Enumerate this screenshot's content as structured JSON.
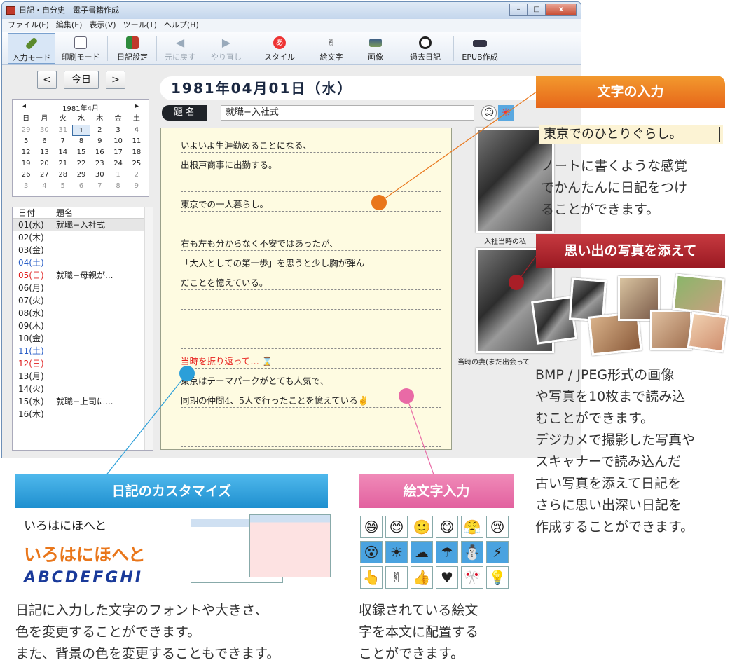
{
  "window": {
    "title": "日記・自分史　電子書籍作成",
    "min": "–",
    "max": "□",
    "close": "x"
  },
  "menu": [
    "ファイル(F)",
    "編集(E)",
    "表示(V)",
    "ツール(T)",
    "ヘルプ(H)"
  ],
  "toolbar": {
    "input_mode": "入力モード",
    "print_mode": "印刷モード",
    "diary_settings": "日記設定",
    "undo": "元に戻す",
    "redo": "やり直し",
    "style": "スタイル",
    "emoji": "絵文字",
    "image": "画像",
    "past_diary": "過去日記",
    "epub": "EPUB作成"
  },
  "nav": {
    "prev": "<",
    "today": "今日",
    "next": ">"
  },
  "calendar": {
    "header": "1981年4月",
    "prev": "◂",
    "next": "▸",
    "weekdays": [
      "日",
      "月",
      "火",
      "水",
      "木",
      "金",
      "土"
    ],
    "days": [
      [
        "29",
        "30",
        "31",
        "1",
        "2",
        "3",
        "4"
      ],
      [
        "5",
        "6",
        "7",
        "8",
        "9",
        "10",
        "11"
      ],
      [
        "12",
        "13",
        "14",
        "15",
        "16",
        "17",
        "18"
      ],
      [
        "19",
        "20",
        "21",
        "22",
        "23",
        "24",
        "25"
      ],
      [
        "26",
        "27",
        "28",
        "29",
        "30",
        "1",
        "2"
      ],
      [
        "3",
        "4",
        "5",
        "6",
        "7",
        "8",
        "9"
      ]
    ]
  },
  "list": {
    "col_date": "日付",
    "col_title": "題名",
    "rows": [
      {
        "d": "01(水)",
        "t": "就職−入社式",
        "c": "#222"
      },
      {
        "d": "02(木)",
        "t": "",
        "c": "#222"
      },
      {
        "d": "03(金)",
        "t": "",
        "c": "#222"
      },
      {
        "d": "04(土)",
        "t": "",
        "c": "#2a5fc7"
      },
      {
        "d": "05(日)",
        "t": "就職−母親が...",
        "c": "#e02020"
      },
      {
        "d": "06(月)",
        "t": "",
        "c": "#222"
      },
      {
        "d": "07(火)",
        "t": "",
        "c": "#222"
      },
      {
        "d": "08(水)",
        "t": "",
        "c": "#222"
      },
      {
        "d": "09(木)",
        "t": "",
        "c": "#222"
      },
      {
        "d": "10(金)",
        "t": "",
        "c": "#222"
      },
      {
        "d": "11(土)",
        "t": "",
        "c": "#2a5fc7"
      },
      {
        "d": "12(日)",
        "t": "",
        "c": "#e02020"
      },
      {
        "d": "13(月)",
        "t": "",
        "c": "#222"
      },
      {
        "d": "14(火)",
        "t": "",
        "c": "#222"
      },
      {
        "d": "15(水)",
        "t": "就職−上司に...",
        "c": "#222"
      },
      {
        "d": "16(木)",
        "t": "",
        "c": "#222"
      }
    ]
  },
  "entry": {
    "date": "1981年04月01日（水）",
    "title_label": "題 名",
    "title_value": "就職−入社式",
    "lines": [
      "いよいよ生涯勤めることになる、",
      "出根戸商事に出勤する。",
      "",
      "東京での一人暮らし。",
      "",
      "右も左も分からなく不安ではあったが、",
      "「大人としての第一歩」を思うと少し胸が弾ん",
      "だことを憶えている。",
      "",
      "",
      "",
      "当時を振り返って… ⌛",
      "東京はテーマパークがとても人気で、",
      "同期の仲間4、5人で行ったことを憶えている✌",
      "",
      ""
    ]
  },
  "photos": {
    "cap1": "入社当時の私",
    "cap2": "当時の妻(まだ出会って"
  },
  "callouts": {
    "text_input": {
      "title": "文字の入力",
      "sample": "東京でのひとりぐらし。",
      "body": [
        "ノートに書くような感覚",
        "でかんたんに日記をつけ",
        "ることができます。"
      ]
    },
    "photo": {
      "title": "思い出の写真を添えて",
      "body": [
        "BMP / JPEG形式の画像",
        "や写真を10枚まで読み込",
        "むことができます。",
        "デジカメで撮影した写真や",
        "スキャナーで読み込んだ",
        "古い写真を添えて日記を",
        "さらに思い出深い日記を",
        "作成することができます。"
      ]
    },
    "custom": {
      "title": "日記のカスタマイズ",
      "font1": "いろはにほへと",
      "font2": "いろはにほへと",
      "font3": "ABCDEFGHI",
      "body": [
        "日記に入力した文字のフォントや大きさ、",
        "色を変更することができます。",
        "また、背景の色を変更することもできます。"
      ]
    },
    "emoji": {
      "title": "絵文字入力",
      "icons": [
        "😄",
        "😊",
        "🙂",
        "😋",
        "😤",
        "😢",
        "😵",
        "☀",
        "☁",
        "☂",
        "⛄",
        "⚡",
        "👆",
        "✌",
        "👍",
        "♥",
        "🎌",
        "💡"
      ],
      "body": [
        "収録されている絵文",
        "字を本文に配置する",
        "ことができます。"
      ]
    }
  },
  "colors": {
    "orange": "#e9761a",
    "darkred": "#a81e27",
    "blue": "#2b9fd9",
    "pink": "#e96aa6"
  }
}
